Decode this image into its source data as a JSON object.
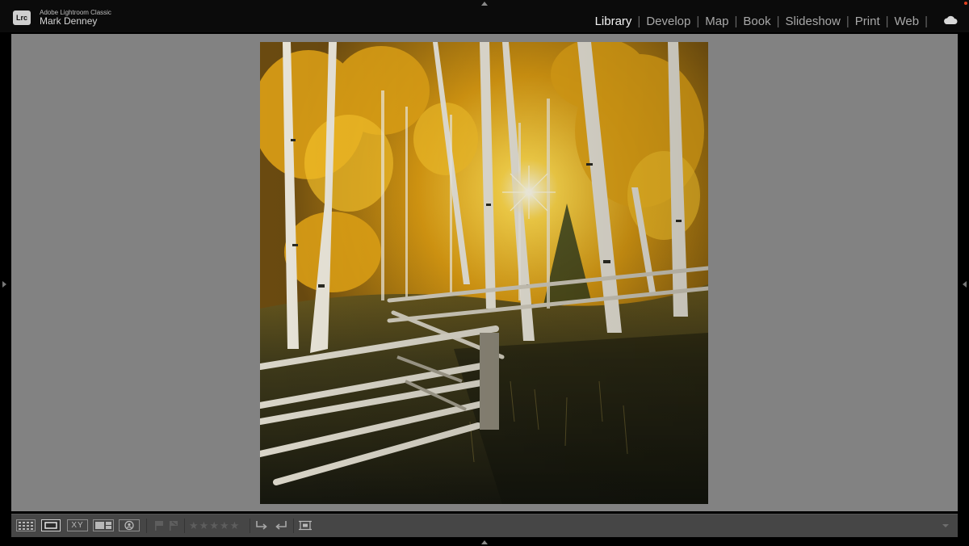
{
  "app": {
    "badge": "Lrc",
    "name": "Adobe Lightroom Classic",
    "user": "Mark Denney"
  },
  "modules": {
    "active": "Library",
    "items": [
      "Library",
      "Develop",
      "Map",
      "Book",
      "Slideshow",
      "Print",
      "Web"
    ]
  },
  "icons": {
    "cloud": "cloud-icon",
    "grid_view": "grid-view-icon",
    "loupe_view": "loupe-view-icon",
    "compare_view": "compare-view-icon",
    "survey_view": "survey-view-icon",
    "people_view": "people-view-icon",
    "flag_pick": "flag-pick-icon",
    "flag_reject": "flag-reject-icon",
    "rotate_left": "rotate-left-icon",
    "rotate_right": "rotate-right-icon",
    "crop_overlay": "crop-overlay-icon",
    "toolbar_menu": "toolbar-menu-icon"
  },
  "toolbar": {
    "compare_label": "XY",
    "rating": 0,
    "rating_max": 5
  },
  "colors": {
    "background": "#828282",
    "toolbar": "#464646",
    "active_module": "#f2f2f2",
    "inactive_module": "#a8a8a8",
    "top_bar": "#0b0b0b"
  }
}
